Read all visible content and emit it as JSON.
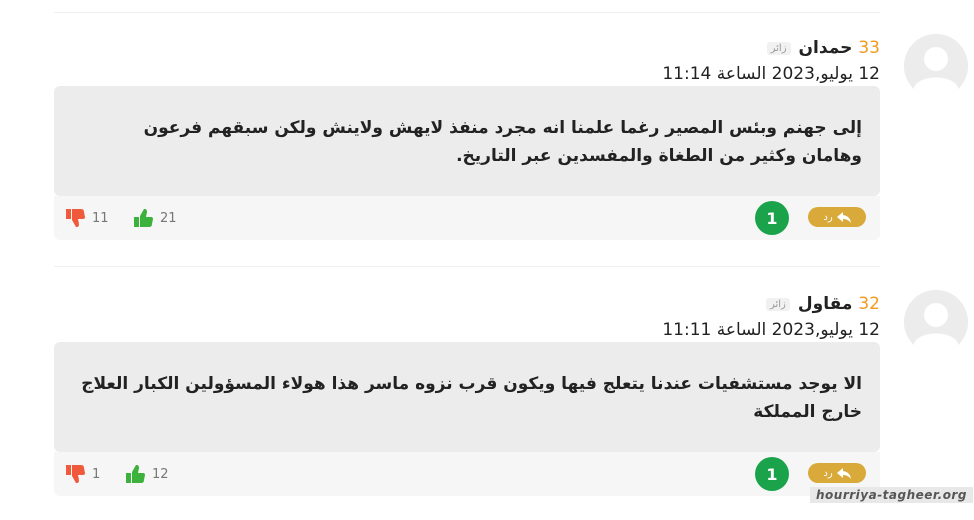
{
  "comments": [
    {
      "number": "33",
      "username": "حمدان",
      "role": "زائر",
      "date": "12 يوليو,2023 الساعة 11:14",
      "text": "إلى جهنم وبئس المصير رغما علمنا انه مجرد منفذ لايهش ولاينش ولكن سبقهم فرعون وهامان وكثير من الطغاة والمفسدين عبر التاريخ.",
      "reply_label": "رد",
      "replies_count": "1",
      "likes": "21",
      "dislikes": "11"
    },
    {
      "number": "32",
      "username": "مقاول",
      "role": "زائر",
      "date": "12 يوليو,2023 الساعة 11:11",
      "text": "الا يوجد مستشفيات عندنا يتعلج فيها ويكون قرب نزوه ماسر هذا هولاء المسؤولين الكبار العلاج خارج المملكة",
      "reply_label": "رد",
      "replies_count": "1",
      "likes": "12",
      "dislikes": "1"
    }
  ],
  "watermark": "hourriya-tagheer.org",
  "colors": {
    "number": "#f39a1d",
    "reply_button": "#d9a93a",
    "count_badge": "#1aa34a",
    "like": "#3cb23c",
    "dislike": "#f05a3c",
    "bubble": "#ececec"
  },
  "icons": {
    "avatar": "default-user-avatar",
    "reply": "reply-arrow-icon",
    "like": "thumbs-up-icon",
    "dislike": "thumbs-down-icon"
  }
}
